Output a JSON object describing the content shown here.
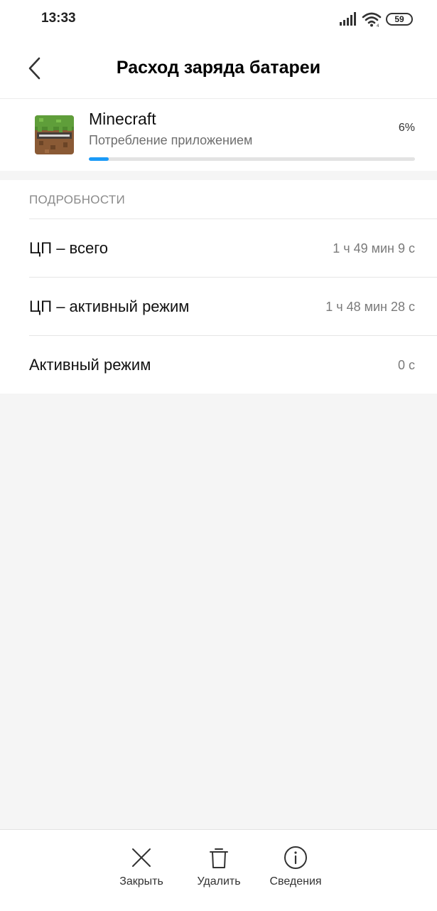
{
  "status_bar": {
    "time": "13:33",
    "battery_level": "59",
    "icons": [
      "signal-icon",
      "wifi-icon",
      "battery-icon"
    ]
  },
  "header": {
    "title": "Расход заряда батареи",
    "back_icon": "chevron-left-icon"
  },
  "app": {
    "name": "Minecraft",
    "subtitle": "Потребление приложением",
    "percent_label": "6%",
    "usage_fraction": 0.06,
    "progress_color": "#1b9af7"
  },
  "details": {
    "header": "ПОДРОБНОСТИ",
    "rows": [
      {
        "label": "ЦП – всего",
        "value": "1 ч 49 мин 9 с"
      },
      {
        "label": "ЦП – активный режим",
        "value": "1 ч 48 мин 28 с"
      },
      {
        "label": "Активный режим",
        "value": "0 с"
      }
    ]
  },
  "bottom_actions": [
    {
      "label": "Закрыть",
      "icon": "close-icon"
    },
    {
      "label": "Удалить",
      "icon": "trash-icon"
    },
    {
      "label": "Сведения",
      "icon": "info-icon"
    }
  ]
}
